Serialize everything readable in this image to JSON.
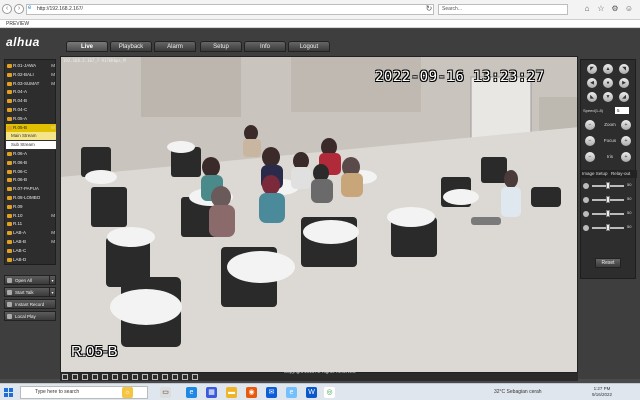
{
  "browser": {
    "url": "http://192.168.2.167/",
    "search_placeholder": "Search...",
    "tab_title": "PREVIEW"
  },
  "app": {
    "logo": "alhua",
    "nav": [
      "Live",
      "Playback",
      "Alarm",
      "Setup",
      "Info",
      "Logout"
    ],
    "active_nav": "Live"
  },
  "channels": [
    {
      "label": "R.01-JAWA",
      "mark": "M"
    },
    {
      "label": "R.02-BALI",
      "mark": "M"
    },
    {
      "label": "R.03-SUMAT",
      "mark": "M"
    },
    {
      "label": "R.04-A",
      "mark": ""
    },
    {
      "label": "R.04-B",
      "mark": ""
    },
    {
      "label": "R.04-C",
      "mark": ""
    },
    {
      "label": "R.05-A",
      "mark": ""
    },
    {
      "label": "R.05-B",
      "mark": "M",
      "selected": true
    },
    {
      "label": "Main Stream",
      "sub": true
    },
    {
      "label": "Sub Stream",
      "sub": true
    },
    {
      "label": "R.06-A",
      "mark": ""
    },
    {
      "label": "R.06-B",
      "mark": ""
    },
    {
      "label": "R.06-C",
      "mark": ""
    },
    {
      "label": "R.06-B",
      "mark": ""
    },
    {
      "label": "R.07-PAPUA",
      "mark": ""
    },
    {
      "label": "R.08-LOMBO",
      "mark": ""
    },
    {
      "label": "R.09",
      "mark": ""
    },
    {
      "label": "R.10",
      "mark": "M"
    },
    {
      "label": "R.11",
      "mark": ""
    },
    {
      "label": "LAB-A",
      "mark": "M"
    },
    {
      "label": "LAB-B",
      "mark": "M"
    },
    {
      "label": "LAB-C",
      "mark": ""
    },
    {
      "label": "LAB-D",
      "mark": ""
    }
  ],
  "actions": {
    "open_all": "Open All",
    "start_talk": "Start Talk",
    "instant_record": "Instant Record",
    "local_play": "Local Play"
  },
  "video": {
    "info": "192.168.2.167_7 9176Kbps_M",
    "timestamp": "2022-09-16  13:23:27",
    "camera_label": "R.05-B"
  },
  "ptz": {
    "speed_label": "Speed(1-8)",
    "speed_value": "5",
    "zoom": "Zoom",
    "focus": "Focus",
    "iris": "Iris",
    "image_setup": "Image Setup",
    "relay_out": "Relay-out",
    "reset": "Reset",
    "sliders": [
      50,
      50,
      50,
      50
    ]
  },
  "footer": "Copyright 2015 All Rights Reserved.",
  "taskbar": {
    "search_placeholder": "Type here to search",
    "weather": "32°C  Sebagian cerah",
    "time": "1:27 PM",
    "date": "9/16/2022"
  }
}
